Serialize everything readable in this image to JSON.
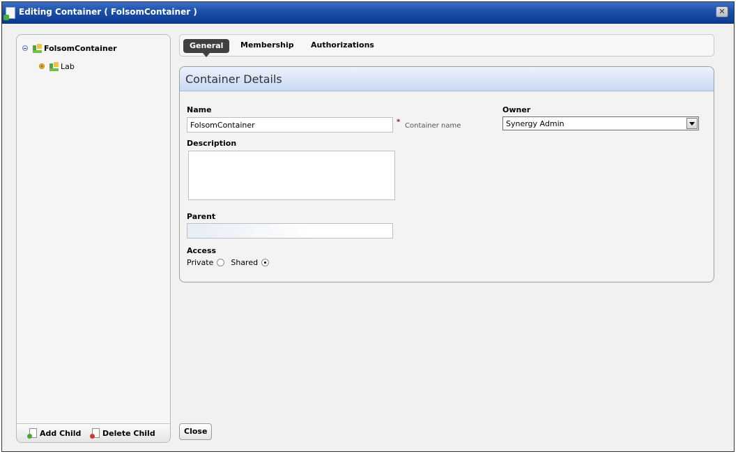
{
  "window": {
    "title": "Editing Container ( FolsomContainer )",
    "close_label": "✕"
  },
  "tree": {
    "items": [
      {
        "label": "FolsomContainer",
        "expander": "collapse-icon",
        "icon": "container-icon"
      },
      {
        "label": "Lab",
        "expander": "expand-icon",
        "icon": "container-icon"
      }
    ]
  },
  "sidebar_footer": {
    "add_child_label": "Add Child",
    "delete_child_label": "Delete Child"
  },
  "tabs": [
    {
      "label": "General",
      "active": true
    },
    {
      "label": "Membership",
      "active": false
    },
    {
      "label": "Authorizations",
      "active": false
    }
  ],
  "panel": {
    "title": "Container Details",
    "name_label": "Name",
    "name_value": "FolsomContainer",
    "name_hint": "Container name",
    "owner_label": "Owner",
    "owner_value": "Synergy Admin",
    "description_label": "Description",
    "description_value": "",
    "parent_label": "Parent",
    "parent_value": "",
    "access_label": "Access",
    "access_options": [
      {
        "label": "Private",
        "checked": false
      },
      {
        "label": "Shared",
        "checked": true
      }
    ]
  },
  "footer": {
    "close_label": "Close"
  },
  "colors": {
    "titlebar": "#1c4fa8",
    "active_tab": "#404040",
    "panel_header": "#d5e2f7",
    "required": "#cc0000"
  }
}
